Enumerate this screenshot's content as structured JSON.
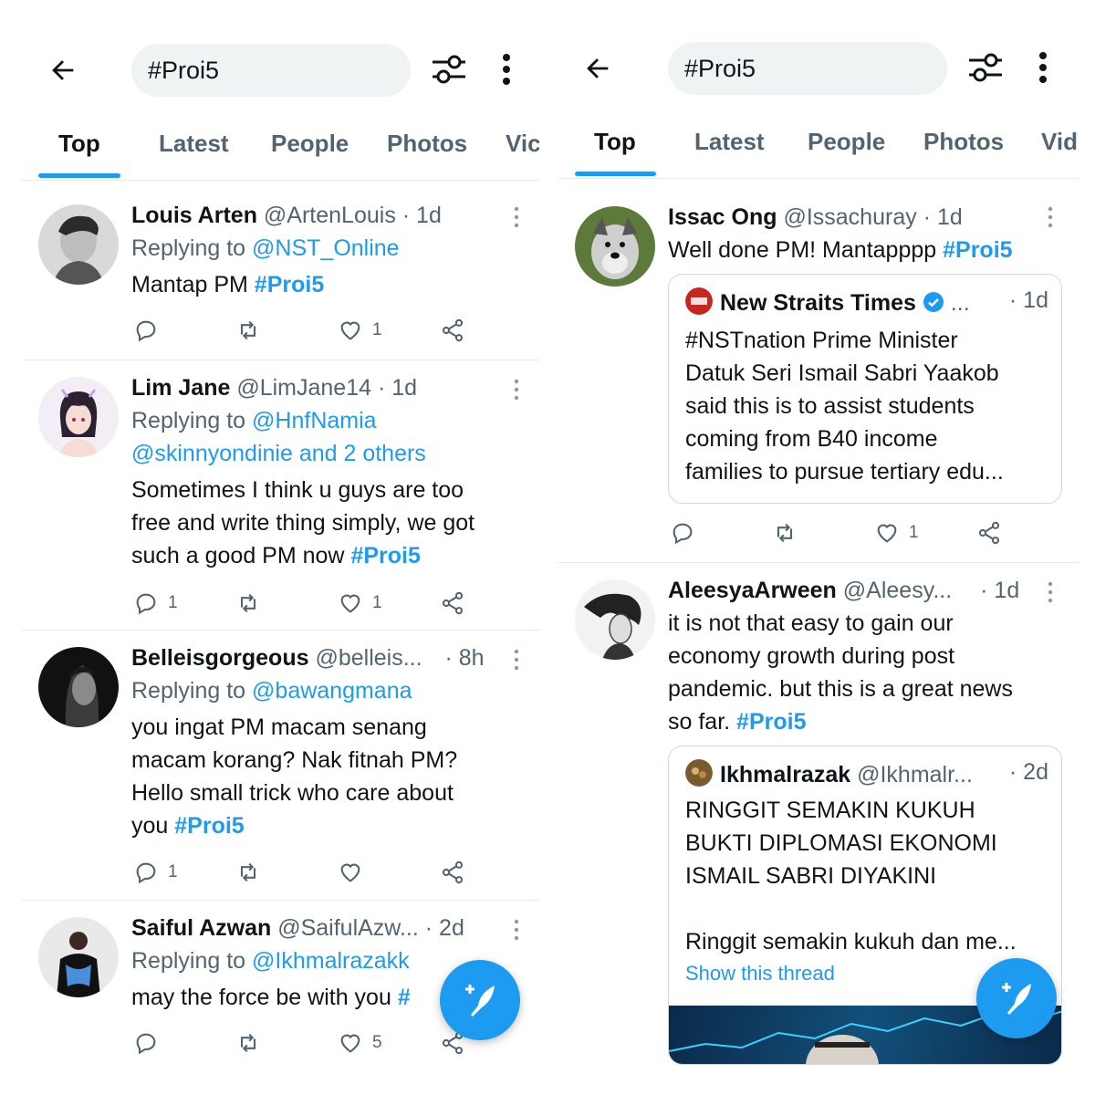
{
  "colors": {
    "accent": "#1d9bf0",
    "text": "#0f1419",
    "muted": "#536471",
    "divider": "#e7e9ea"
  },
  "left": {
    "search": {
      "value": "#Proi5"
    },
    "tabs": [
      "Top",
      "Latest",
      "People",
      "Photos",
      "Vic"
    ],
    "tweets": [
      {
        "name": "Louis Arten",
        "handle": "@ArtenLouis",
        "time": "· 1d",
        "replying_prefix": "Replying to",
        "replying_to": "@NST_Online",
        "text": "Mantap PM",
        "hashtag": "#Proi5",
        "replies": "",
        "likes": "1"
      },
      {
        "name": "Lim Jane",
        "handle": "@LimJane14",
        "time": "· 1d",
        "replying_prefix": "Replying to",
        "replying_to": "@HnfNamia",
        "replying_to_2": "@skinnyondinie and 2 others",
        "text_lines": [
          "Sometimes I think u guys are too",
          "free and write thing simply, we got",
          "such a good PM now"
        ],
        "hashtag": "#Proi5",
        "replies": "1",
        "likes": "1"
      },
      {
        "name": "Belleisgorgeous",
        "handle": "@belleis...",
        "time": "· 8h",
        "replying_prefix": "Replying to",
        "replying_to": "@bawangmana",
        "text_lines": [
          "you ingat PM macam senang",
          "macam korang? Nak fitnah PM?",
          "Hello small trick who care about",
          "you"
        ],
        "hashtag": "#Proi5",
        "replies": "1",
        "likes": ""
      },
      {
        "name": "Saiful Azwan",
        "handle": "@SaifulAzw...",
        "time": "· 2d",
        "replying_prefix": "Replying to",
        "replying_to": "@Ikhmalrazakk",
        "text": "may the force be with you",
        "hashtag": "#",
        "replies": "",
        "likes": "5"
      }
    ]
  },
  "right": {
    "search": {
      "value": "#Proi5"
    },
    "tabs": [
      "Top",
      "Latest",
      "People",
      "Photos",
      "Vid"
    ],
    "tweets": [
      {
        "name": "Issac Ong",
        "handle": "@Issachuray",
        "time": "· 1d",
        "text": "Well done PM! Mantapppp",
        "hashtag": "#Proi5",
        "quote": {
          "name": "New Straits Times",
          "ellipsis": "...",
          "time": "· 1d",
          "lines": [
            "#NSTnation Prime Minister",
            "Datuk Seri Ismail Sabri Yaakob",
            "said this is to assist students",
            "coming from B40 income",
            "families to pursue tertiary edu..."
          ]
        },
        "replies": "",
        "likes": "1"
      },
      {
        "name": "AleesyaArween",
        "handle": "@Aleesy...",
        "time": "· 1d",
        "text_lines": [
          "it is not that easy to gain our",
          "economy growth during post",
          "pandemic. but this is a great news",
          "so far."
        ],
        "hashtag": "#Proi5",
        "quote": {
          "name": "Ikhmalrazak",
          "handle": "@Ikhmalr...",
          "time": "· 2d",
          "lines": [
            "RINGGIT SEMAKIN KUKUH",
            "BUKTI DIPLOMASI EKONOMI",
            "ISMAIL SABRI DIYAKINI"
          ],
          "lines_2": [
            "Ringgit semakin kukuh dan me..."
          ],
          "show_thread": "Show this thread"
        }
      }
    ]
  }
}
